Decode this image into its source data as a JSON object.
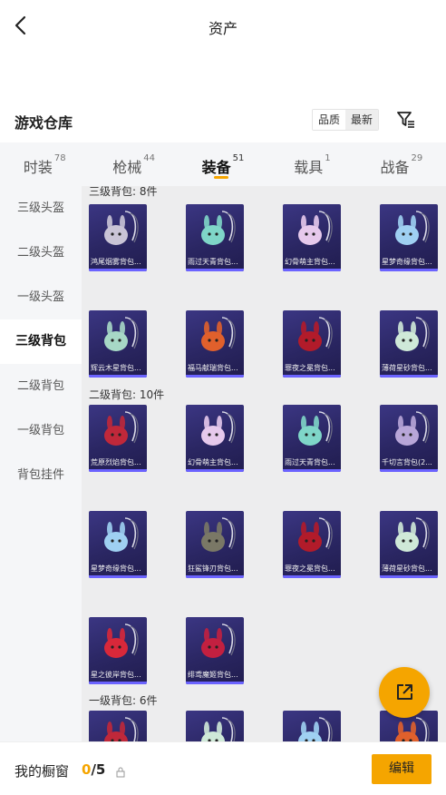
{
  "header": {
    "title": "资产"
  },
  "section": {
    "title": "游戏仓库",
    "sort_options": [
      "品质",
      "最新"
    ],
    "sort_active": 1
  },
  "tabs": [
    {
      "label": "时装",
      "count": "78"
    },
    {
      "label": "枪械",
      "count": "44"
    },
    {
      "label": "装备",
      "count": "51",
      "active": true
    },
    {
      "label": "载具",
      "count": "1"
    },
    {
      "label": "战备",
      "count": "29"
    }
  ],
  "sidebar": {
    "items": [
      {
        "label": "三级头盔"
      },
      {
        "label": "二级头盔"
      },
      {
        "label": "一级头盔"
      },
      {
        "label": "三级背包",
        "active": true
      },
      {
        "label": "二级背包"
      },
      {
        "label": "一级背包"
      },
      {
        "label": "背包挂件"
      }
    ]
  },
  "groups": [
    {
      "title": "三级背包: 8件",
      "items": [
        {
          "label": "鸿尾烟雾背包...",
          "color": "#c9c4d6"
        },
        {
          "label": "雨过天青背包...",
          "color": "#7fd6c8"
        },
        {
          "label": "幻骨萌主背包...",
          "color": "#e6c9ec"
        },
        {
          "label": "星梦奇缘背包...",
          "color": "#9fd0f2"
        },
        {
          "label": "辉云木星背包...",
          "color": "#a7d8c6"
        },
        {
          "label": "福马献瑞背包...",
          "color": "#e0602c"
        },
        {
          "label": "罪夜之冕背包...",
          "color": "#b21b2a"
        },
        {
          "label": "薄荷星砂背包...",
          "color": "#cfe9d8"
        }
      ]
    },
    {
      "title": "二级背包: 10件",
      "items": [
        {
          "label": "荒原烈焰背包...",
          "color": "#c0283a"
        },
        {
          "label": "幻骨萌主背包...",
          "color": "#e6c9ec"
        },
        {
          "label": "雨过天青背包...",
          "color": "#7fd6c8"
        },
        {
          "label": "千切言背包(2...",
          "color": "#b8a6d8"
        },
        {
          "label": "星梦奇缘背包...",
          "color": "#9fd0f2"
        },
        {
          "label": "狂鲨锋刃背包...",
          "color": "#7a7866"
        },
        {
          "label": "罪夜之冕背包...",
          "color": "#b21b2a"
        },
        {
          "label": "薄荷星砂背包...",
          "color": "#cfe9d8"
        },
        {
          "label": "星之彼岸背包...",
          "color": "#d8283a"
        },
        {
          "label": "绯鸢魔姬背包...",
          "color": "#c22040"
        }
      ]
    },
    {
      "title": "一级背包: 6件",
      "items": [
        {
          "label": "",
          "color": "#c0283a"
        },
        {
          "label": "",
          "color": "#cfe9d8"
        },
        {
          "label": "",
          "color": "#9fd0f2"
        },
        {
          "label": "",
          "color": "#e0602c"
        }
      ]
    }
  ],
  "footer": {
    "label": "我的橱窗",
    "count_current": "0",
    "count_total": "/5",
    "edit_label": "编辑"
  },
  "colors": {
    "accent": "#f5a500",
    "card_bg": "#2c2866",
    "card_strip": "#6b63ff"
  }
}
